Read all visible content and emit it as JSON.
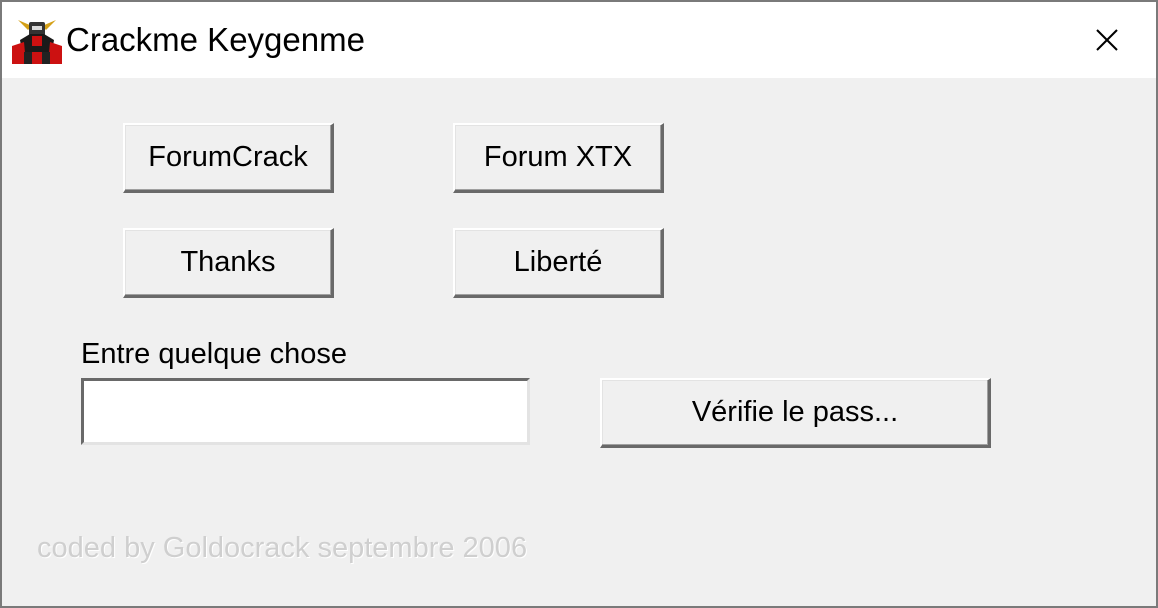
{
  "window": {
    "title": "Crackme Keygenme",
    "icon": "robot-icon",
    "close_icon": "close-icon"
  },
  "buttons": {
    "forumcrack": "ForumCrack",
    "forum_xtx": "Forum XTX",
    "thanks": "Thanks",
    "liberte": "Liberté",
    "verify": "Vérifie le pass..."
  },
  "form": {
    "label": "Entre quelque chose",
    "value": "",
    "placeholder": ""
  },
  "footer": {
    "credit": "coded by Goldocrack septembre 2006"
  }
}
